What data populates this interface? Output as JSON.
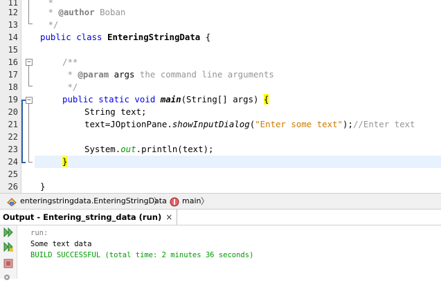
{
  "editor": {
    "lines": [
      {
        "num": "11",
        "text": " *"
      },
      {
        "num": "12",
        "tag": "@author",
        "rest": " Boban"
      },
      {
        "num": "13",
        "text": " */"
      },
      {
        "num": "14",
        "kw": "public class ",
        "name": "EnteringStringData",
        "rest": " {"
      },
      {
        "num": "15"
      },
      {
        "num": "16",
        "text": "/**"
      },
      {
        "num": "17",
        "tag": "@param",
        "param": "args",
        "rest": " the command line arguments"
      },
      {
        "num": "18",
        "text": " */"
      },
      {
        "num": "19",
        "kw": "public static void ",
        "name": "main",
        "rest": "(String[] args) ",
        "brace": "{"
      },
      {
        "num": "20",
        "text": "String text;"
      },
      {
        "num": "21",
        "pre": "text=JOptionPane.",
        "method": "showInputDialog",
        "paren": "(",
        "str": "\"Enter some text\"",
        "post": ");",
        "comment": "//Enter text"
      },
      {
        "num": "22"
      },
      {
        "num": "23",
        "pre": "System.",
        "field": "out",
        "post": ".println(text);"
      },
      {
        "num": "24",
        "brace": "}"
      },
      {
        "num": "25"
      },
      {
        "num": "26",
        "text": "}"
      }
    ]
  },
  "breadcrumb": {
    "class_path": "enteringstringdata.EnteringStringData",
    "method": "main"
  },
  "output": {
    "tab_label": "Output - Entering_string_data (run)",
    "close_label": "×",
    "lines": [
      {
        "text": "run:",
        "color": "#808080"
      },
      {
        "text": "Some text data",
        "color": "#000000"
      },
      {
        "text": "BUILD SUCCESSFUL (total time: 2 minutes 36 seconds)",
        "color": "#009900"
      }
    ]
  },
  "colors": {
    "keyword": "#0000e6",
    "string": "#ce7b00",
    "comment": "#969696",
    "success": "#009900",
    "current_line": "#e8f2fe",
    "brace_highlight": "#ffff00"
  }
}
